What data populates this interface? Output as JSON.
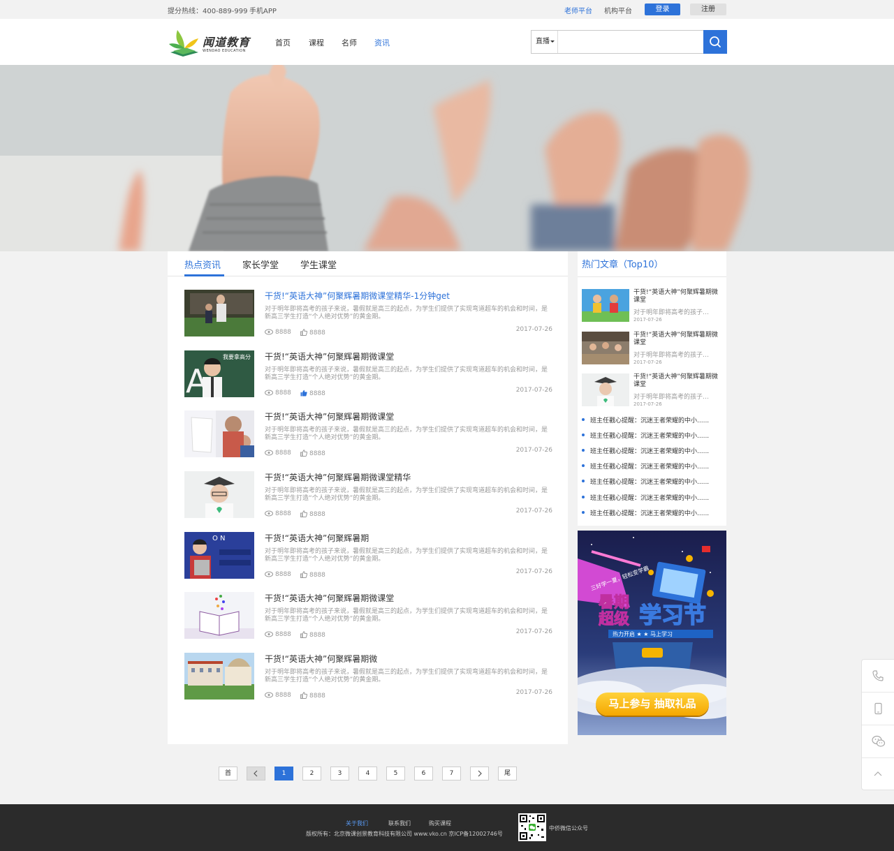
{
  "topbar": {
    "hotline": "提分热线：400-889-999",
    "app": "手机APP",
    "teacher": "老师平台",
    "org": "机构平台",
    "login": "登录",
    "register": "注册"
  },
  "brand": {
    "name_cn": "闻道教育",
    "name_en": "WENDAO EDUCATION"
  },
  "nav": [
    "首页",
    "课程",
    "名师",
    "资讯"
  ],
  "search": {
    "type": "直播",
    "placeholder": ""
  },
  "tabs": [
    "热点资讯",
    "家长学堂",
    "学生课堂"
  ],
  "articles": [
    {
      "title": "干货!“英语大神”何聚辉暑期微课堂精华-1分钟get",
      "desc": "对于明年即将高考的孩子来说，暑假就是高三的起点，为学生们提供了实现弯道超车的机会和时间，是新高三学生打造“个人绝对优势”的黄金期。",
      "views": "8888",
      "likes": "8888",
      "date": "2017-07-26"
    },
    {
      "title": "干货!“英语大神”何聚辉暑期微课堂",
      "desc": "对于明年即将高考的孩子来说，暑假就是高三的起点，为学生们提供了实现弯道超车的机会和时间，是新高三学生打造“个人绝对优势”的黄金期。",
      "views": "8888",
      "likes": "8888",
      "date": "2017-07-26"
    },
    {
      "title": "干货!“英语大神”何聚辉暑期微课堂",
      "desc": "对于明年即将高考的孩子来说，暑假就是高三的起点，为学生们提供了实现弯道超车的机会和时间，是新高三学生打造“个人绝对优势”的黄金期。",
      "views": "8888",
      "likes": "8888",
      "date": "2017-07-26"
    },
    {
      "title": "干货!“英语大神”何聚辉暑期微课堂精华",
      "desc": "对于明年即将高考的孩子来说，暑假就是高三的起点，为学生们提供了实现弯道超车的机会和时间，是新高三学生打造“个人绝对优势”的黄金期。",
      "views": "8888",
      "likes": "8888",
      "date": "2017-07-26"
    },
    {
      "title": "干货!“英语大神”何聚辉暑期",
      "desc": "对于明年即将高考的孩子来说，暑假就是高三的起点，为学生们提供了实现弯道超车的机会和时间，是新高三学生打造“个人绝对优势”的黄金期。",
      "views": "8888",
      "likes": "8888",
      "date": "2017-07-26"
    },
    {
      "title": "干货!“英语大神”何聚辉暑期微课堂",
      "desc": "对于明年即将高考的孩子来说，暑假就是高三的起点，为学生们提供了实现弯道超车的机会和时间，是新高三学生打造“个人绝对优势”的黄金期。",
      "views": "8888",
      "likes": "8888",
      "date": "2017-07-26"
    },
    {
      "title": "干货!“英语大神”何聚辉暑期微",
      "desc": "对于明年即将高考的孩子来说，暑假就是高三的起点，为学生们提供了实现弯道超车的机会和时间，是新高三学生打造“个人绝对优势”的黄金期。",
      "views": "8888",
      "likes": "8888",
      "date": "2017-07-26"
    }
  ],
  "sidebar": {
    "title": "热门文章（Top10）",
    "top": [
      {
        "title": "干货!“英语大神”何聚辉暑期微课堂",
        "desc": "对于明年即将高考的孩子…",
        "date": "2017-07-26"
      },
      {
        "title": "干货!“英语大神”何聚辉暑期微课堂",
        "desc": "对于明年即将高考的孩子…",
        "date": "2017-07-26"
      },
      {
        "title": "干货!“英语大神”何聚辉暑期微课堂",
        "desc": "对于明年即将高考的孩子…",
        "date": "2017-07-26"
      }
    ],
    "list": [
      "班主任戳心提醒：沉迷王者荣耀的中小......",
      "班主任戳心提醒：沉迷王者荣耀的中小......",
      "班主任戳心提醒：沉迷王者荣耀的中小......",
      "班主任戳心提醒：沉迷王者荣耀的中小......",
      "班主任戳心提醒：沉迷王者荣耀的中小......",
      "班主任戳心提醒：沉迷王者荣耀的中小......",
      "班主任戳心提醒：沉迷王者荣耀的中小......"
    ]
  },
  "ad": {
    "line1": "暑期",
    "line2": "超级",
    "big": "学习节",
    "tag": "三好学一夏，轻松变学霸",
    "bar": "热力开启 ★ ★ 马上学习",
    "cta": "马上参与 抽取礼品"
  },
  "pager": [
    "首",
    "‹",
    "1",
    "2",
    "3",
    "4",
    "5",
    "6",
    "7",
    "›",
    "尾"
  ],
  "pager_current": "1",
  "footer": {
    "about": "关于我们",
    "contact": "联系我们",
    "buy": "购买课程",
    "copyright": "版权所有：北京微课创景教育科技有限公司 www.vko.cn 京ICP备12002746号",
    "wechat": "中侨微信公众号"
  },
  "colors": {
    "accent": "#2d72d9",
    "footer_bg": "#2b2b2b",
    "page_bg": "#f2f2f2"
  }
}
